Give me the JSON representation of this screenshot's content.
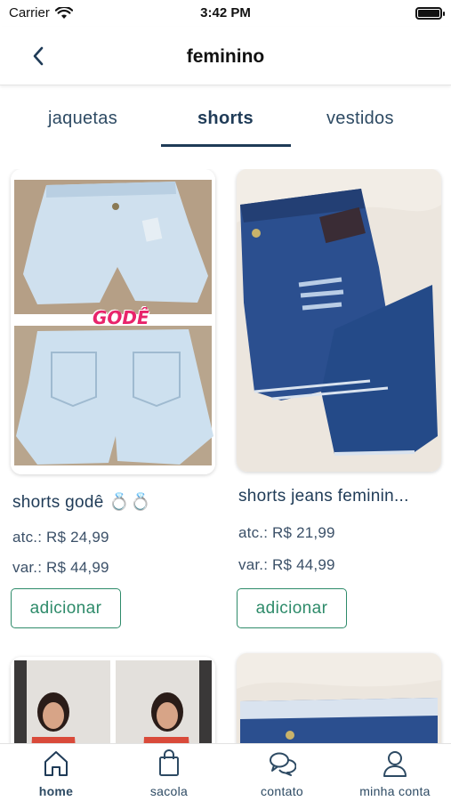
{
  "status_bar": {
    "carrier": "Carrier",
    "time": "3:42 PM"
  },
  "header": {
    "title": "feminino"
  },
  "tabs": [
    {
      "label": "jaquetas",
      "active": false
    },
    {
      "label": "shorts",
      "active": true
    },
    {
      "label": "vestidos",
      "active": false
    }
  ],
  "products": [
    {
      "name": "shorts godê 💍💍",
      "atc": "atc.: R$ 24,99",
      "var": "var.: R$ 44,99",
      "button": "adicionar",
      "badge": "GODÊ"
    },
    {
      "name": "shorts jeans feminin...",
      "atc": "atc.: R$ 21,99",
      "var": "var.: R$ 44,99",
      "button": "adicionar"
    },
    {
      "name": "",
      "atc": "",
      "var": "",
      "button": ""
    },
    {
      "name": "",
      "atc": "",
      "var": "",
      "button": ""
    }
  ],
  "tab_bar": [
    {
      "label": "home",
      "icon": "home-icon",
      "active": true
    },
    {
      "label": "sacola",
      "icon": "shopping-bag-icon",
      "active": false
    },
    {
      "label": "contato",
      "icon": "chat-icon",
      "active": false
    },
    {
      "label": "minha conta",
      "icon": "user-icon",
      "active": false
    }
  ],
  "colors": {
    "primary": "#1f3b57",
    "accent": "#2e8b6a",
    "badge": "#e8246b"
  }
}
